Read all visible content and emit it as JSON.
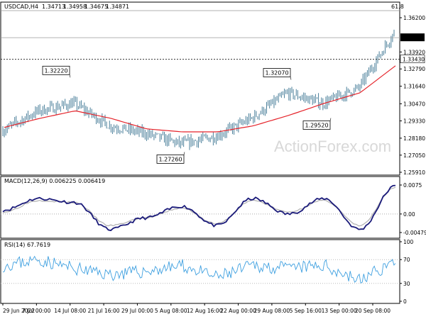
{
  "header": {
    "symbol": "USDCAD,H4",
    "open": "1.34713",
    "high": "1.34958",
    "low": "1.34675",
    "close": "1.34871"
  },
  "price_pane": {
    "top_level_label": "61.8",
    "current_price_tag": "1.34871",
    "horizontal_level_tag": "1.33430",
    "yticks": [
      "1.36200",
      "1.33920",
      "1.32790",
      "1.31640",
      "1.30470",
      "1.29330",
      "1.28180",
      "1.27050",
      "1.25910"
    ]
  },
  "annotations": [
    "1.32220",
    "1.27260",
    "1.32070",
    "1.29520"
  ],
  "watermark": "ActionForex.com",
  "macd_pane": {
    "label": "MACD(12,26,9) 0.006225 0.006419",
    "yticks": [
      "0.0075",
      "0.00",
      "-0.004795"
    ]
  },
  "rsi_pane": {
    "label": "RSI(14) 67.7619",
    "yticks": [
      "100",
      "70",
      "30",
      "0"
    ]
  },
  "x_axis": {
    "ticks": [
      "29 Jun 2022",
      "7 Jul 00:00",
      "14 Jul 08:00",
      "21 Jul 16:00",
      "29 Jul 00:00",
      "5 Aug 08:00",
      "12 Aug 16:00",
      "22 Aug 00:00",
      "29 Aug 08:00",
      "5 Sep 16:00",
      "13 Sep 00:00",
      "20 Sep 08:00"
    ]
  },
  "colors": {
    "candle": "#4a7f9a",
    "ma": "#e5232a",
    "macd": "#1a1a7a",
    "signal": "#b0b0b0",
    "rsi": "#3fa0e0",
    "grid": "#c8c8c8"
  },
  "chart_data": [
    {
      "type": "line",
      "title": "USDCAD,H4",
      "x": [
        "29 Jun 2022",
        "7 Jul 00:00",
        "14 Jul 08:00",
        "21 Jul 16:00",
        "29 Jul 00:00",
        "5 Aug 08:00",
        "12 Aug 16:00",
        "22 Aug 00:00",
        "29 Aug 08:00",
        "5 Sep 16:00",
        "13 Sep 00:00",
        "20 Sep 08:00"
      ],
      "ylim": [
        1.2591,
        1.362
      ],
      "series": [
        {
          "values": [
            1.287,
            1.3,
            1.305,
            1.29,
            1.285,
            1.278,
            1.283,
            1.295,
            1.312,
            1.305,
            1.315,
            1.352
          ]
        },
        {
          "values": [
            1.289,
            1.295,
            1.3,
            1.295,
            1.288,
            1.286,
            1.286,
            1.29,
            1.297,
            1.305,
            1.312,
            1.33
          ]
        }
      ],
      "annotations": [
        "1.32220",
        "1.27260",
        "1.32070",
        "1.29520"
      ],
      "hlines": [
        1.3343,
        1.34871
      ]
    },
    {
      "type": "line",
      "title": "MACD(12,26,9) 0.006225 0.006419",
      "ylim": [
        -0.004795,
        0.0075
      ],
      "series": [
        {
          "values": [
            0.001,
            0.004,
            0.003,
            -0.004,
            -0.001,
            0.002,
            -0.003,
            0.004,
            0.0,
            0.004,
            -0.004,
            0.0072
          ]
        },
        {
          "values": [
            0.0005,
            0.0035,
            0.003,
            -0.003,
            -0.001,
            0.0015,
            -0.0025,
            0.0035,
            0.0005,
            0.0035,
            -0.003,
            0.0068
          ]
        }
      ]
    },
    {
      "type": "line",
      "title": "RSI(14) 67.7619",
      "ylim": [
        0,
        100
      ],
      "series": [
        {
          "values": [
            60,
            70,
            55,
            45,
            50,
            60,
            40,
            60,
            55,
            60,
            35,
            68
          ]
        }
      ]
    }
  ]
}
